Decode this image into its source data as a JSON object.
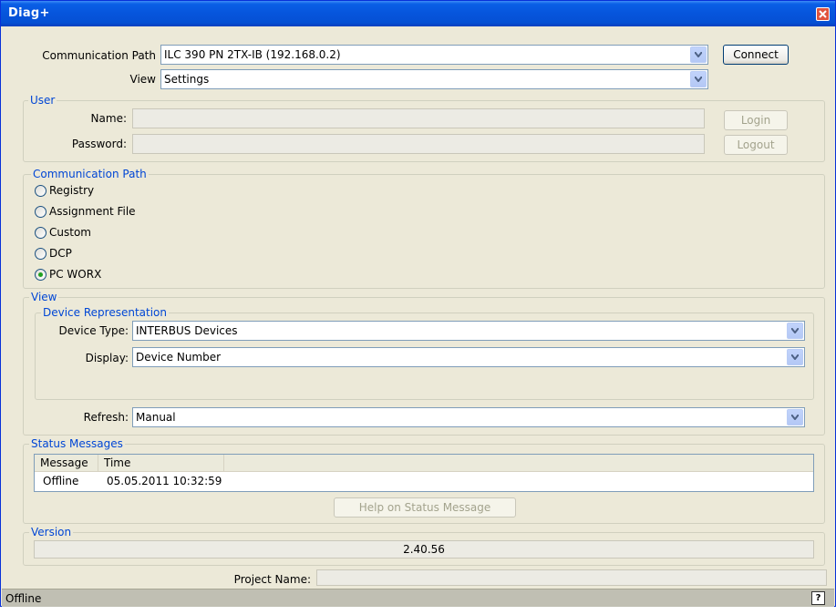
{
  "window": {
    "title": "Diag+"
  },
  "top": {
    "comm_path_label": "Communication Path",
    "comm_path_value": "ILC 390 PN 2TX-IB (192.168.0.2)",
    "view_label": "View",
    "view_value": "Settings",
    "connect_label": "Connect"
  },
  "user": {
    "group_title": "User",
    "name_label": "Name:",
    "name_value": "",
    "password_label": "Password:",
    "password_value": "",
    "login_label": "Login",
    "logout_label": "Logout"
  },
  "comm_path_group": {
    "title": "Communication Path",
    "options": [
      {
        "label": "Registry",
        "checked": false
      },
      {
        "label": "Assignment File",
        "checked": false
      },
      {
        "label": "Custom",
        "checked": false
      },
      {
        "label": "DCP",
        "checked": false
      },
      {
        "label": "PC WORX",
        "checked": true
      }
    ]
  },
  "view_group": {
    "title": "View",
    "device_rep_title": "Device Representation",
    "device_type_label": "Device Type:",
    "device_type_value": "INTERBUS Devices",
    "display_label": "Display:",
    "display_value": "Device Number",
    "refresh_label": "Refresh:",
    "refresh_value": "Manual"
  },
  "status_messages": {
    "title": "Status Messages",
    "columns": [
      "Message",
      "Time"
    ],
    "rows": [
      {
        "message": "Offline",
        "time": "05.05.2011 10:32:59"
      }
    ],
    "help_button_label": "Help on Status Message"
  },
  "version": {
    "title": "Version",
    "value": "2.40.56"
  },
  "project": {
    "label": "Project Name:",
    "value": ""
  },
  "statusbar": {
    "text": "Offline",
    "help_icon_text": "?"
  },
  "colors": {
    "title_bar": "#0655dc",
    "group_title": "#0046d5",
    "radio_checked": "#21a121"
  }
}
